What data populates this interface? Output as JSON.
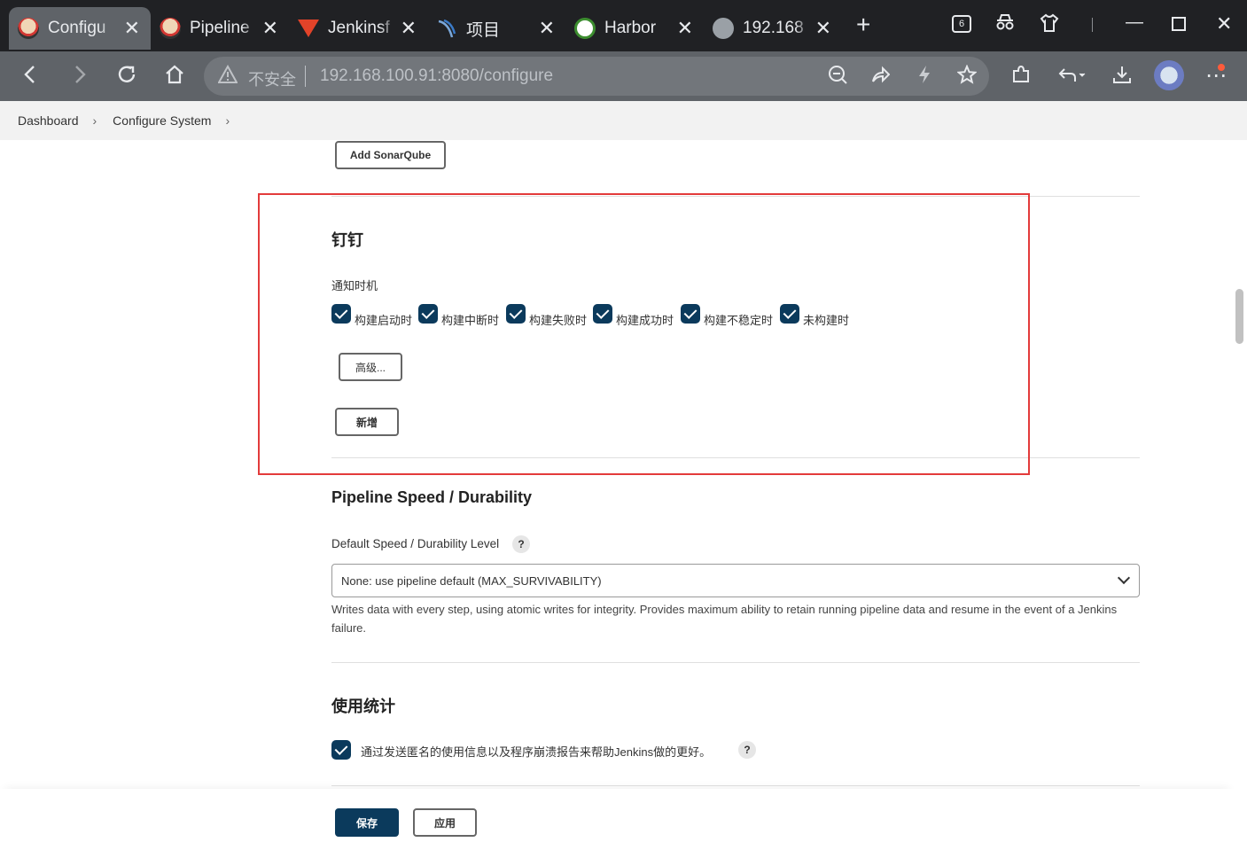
{
  "browser": {
    "tabs": [
      {
        "label": "Configu",
        "icon": "jenkins-icon",
        "active": true
      },
      {
        "label": "Pipeline",
        "icon": "jenkins-icon",
        "active": false
      },
      {
        "label": "Jenkinsf",
        "icon": "gitlab-icon",
        "active": false
      },
      {
        "label": "项目",
        "icon": "project-icon",
        "active": false
      },
      {
        "label": "Harbor",
        "icon": "harbor-icon",
        "active": false
      },
      {
        "label": "192.168",
        "icon": "browser-e-icon",
        "active": false
      }
    ],
    "tab_count_badge": "6",
    "address": {
      "security_label": "不安全",
      "url": "192.168.100.91:8080/configure"
    }
  },
  "breadcrumb": {
    "items": [
      "Dashboard",
      "Configure System"
    ]
  },
  "sonarqube": {
    "add_button": "Add SonarQube"
  },
  "dingtalk": {
    "title": "钉钉",
    "notify_label": "通知时机",
    "options": [
      "构建启动时",
      "构建中断时",
      "构建失败时",
      "构建成功时",
      "构建不稳定时",
      "未构建时"
    ],
    "advanced_button": "高级...",
    "add_button": "新增"
  },
  "pipeline_speed": {
    "title": "Pipeline Speed / Durability",
    "field_label": "Default Speed / Durability Level",
    "help": "?",
    "selected": "None: use pipeline default (MAX_SURVIVABILITY)",
    "description": "Writes data with every step, using atomic writes for integrity.  Provides maximum ability to retain running pipeline data and resume in the event of a Jenkins failure."
  },
  "usage_stats": {
    "title": "使用统计",
    "checkbox_label": "通过发送匿名的使用信息以及程序崩溃报告来帮助Jenkins做的更好。",
    "help": "?"
  },
  "footer": {
    "save_button": "保存",
    "apply_button": "应用"
  },
  "colors": {
    "primary": "#0b3a5c",
    "highlight_box": "#e33b3b"
  }
}
